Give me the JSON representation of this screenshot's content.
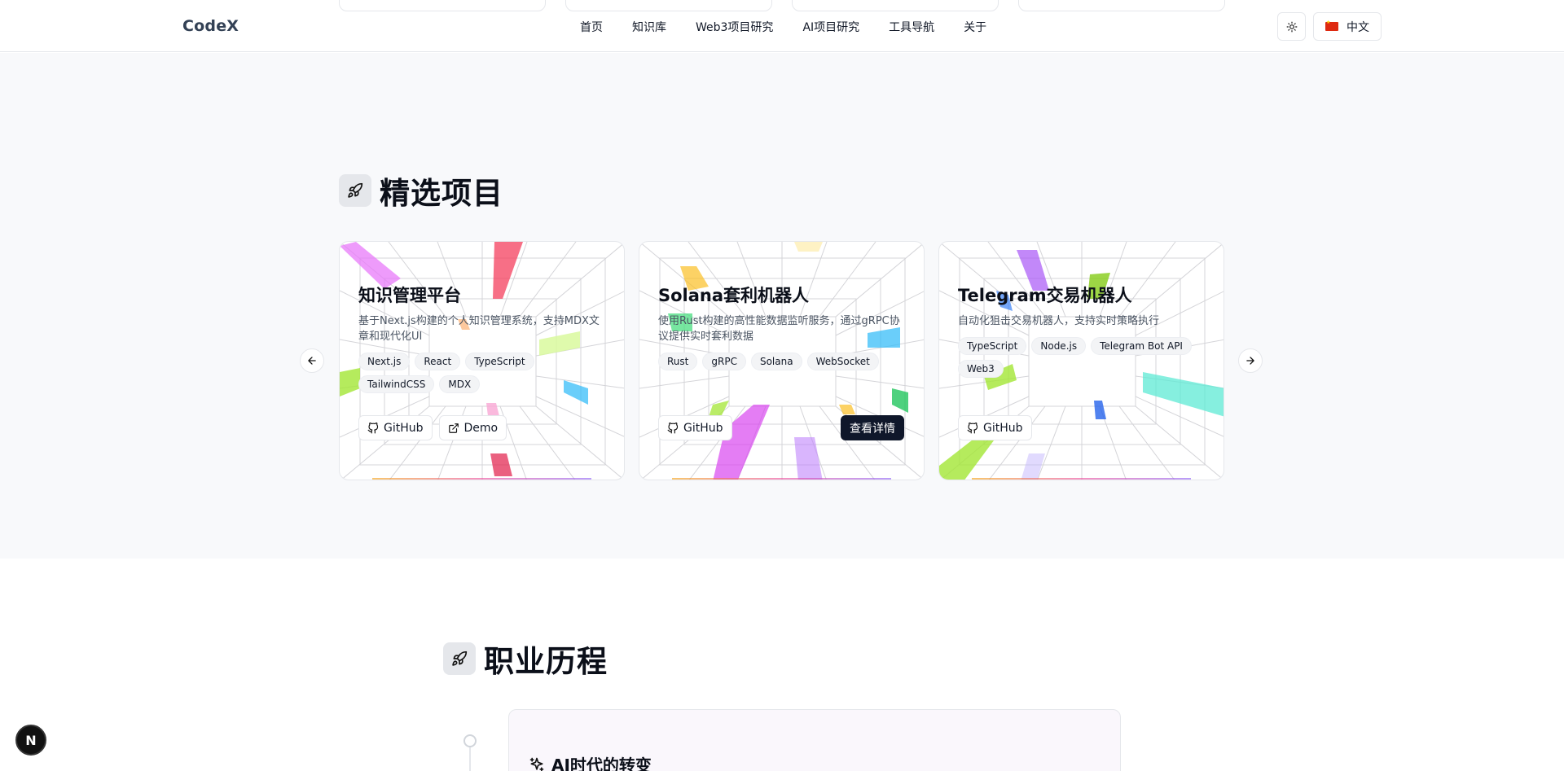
{
  "header": {
    "logo": "CodeX",
    "nav": [
      "首页",
      "知识库",
      "Web3项目研究",
      "AI项目研究",
      "工具导航",
      "关于"
    ],
    "language": "中文",
    "theme_icon": "sun-icon"
  },
  "projects": {
    "title": "精选项目",
    "title_icon": "rocket-icon",
    "cards": [
      {
        "title": "知识管理平台",
        "description": "基于Next.js构建的个人知识管理系统，支持MDX文章和现代化UI",
        "tags": [
          "Next.js",
          "React",
          "TypeScript",
          "TailwindCSS",
          "MDX"
        ],
        "github": "GitHub",
        "demo": "Demo"
      },
      {
        "title": "Solana套利机器人",
        "description": "使用Rust构建的高性能数据监听服务，通过gRPC协议提供实时套利数据",
        "tags": [
          "Rust",
          "gRPC",
          "Solana",
          "WebSocket"
        ],
        "github": "GitHub",
        "details": "查看详情"
      },
      {
        "title": "Telegram交易机器人",
        "description": "自动化狙击交易机器人，支持实时策略执行",
        "tags": [
          "TypeScript",
          "Node.js",
          "Telegram Bot API",
          "Web3"
        ],
        "github": "GitHub"
      }
    ]
  },
  "career": {
    "title": "职业历程",
    "title_icon": "rocket-icon",
    "first_item": "AI时代的转变",
    "first_item_icon": "sparkles-icon"
  },
  "badge": "N"
}
